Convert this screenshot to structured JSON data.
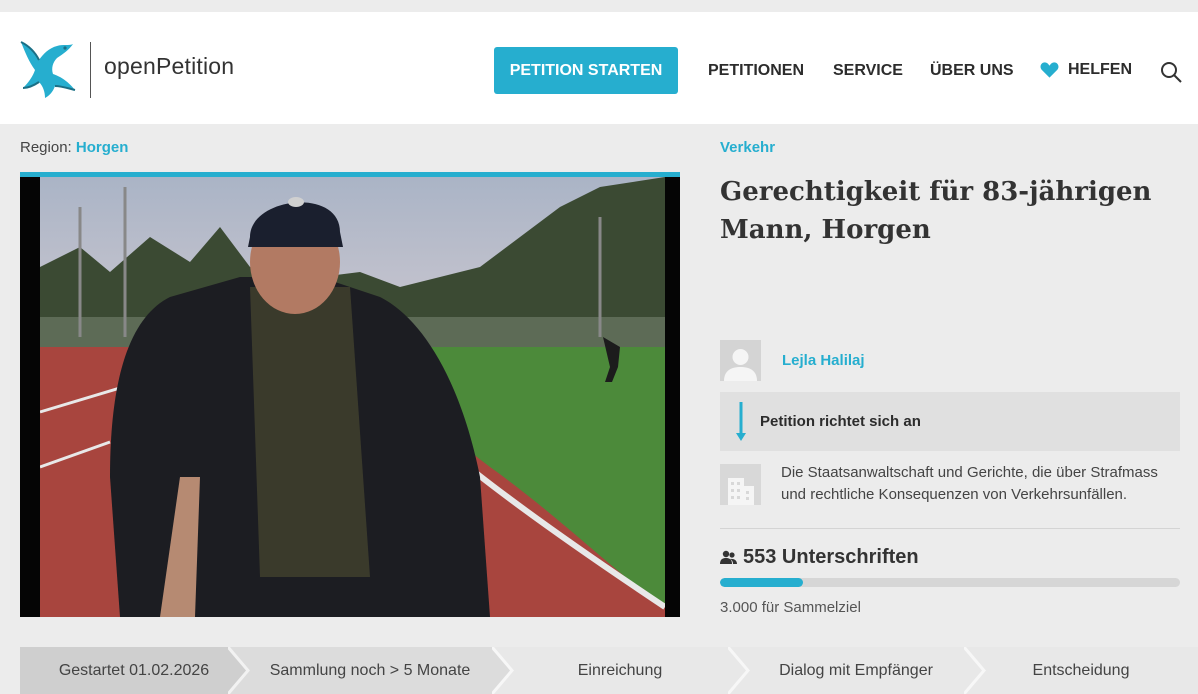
{
  "header": {
    "logo_text": "openPetition",
    "start_button": "PETITION STARTEN",
    "nav": {
      "petitionen": "PETITIONEN",
      "service": "SERVICE",
      "ueber_uns": "ÜBER UNS",
      "helfen": "HELFEN"
    },
    "icons": [
      "dove-logo-icon",
      "heart-icon",
      "search-icon"
    ]
  },
  "petition": {
    "region_label": "Region:",
    "region_value": "Horgen",
    "category": "Verkehr",
    "title": "Gerechtigkeit für 83-jährigen Mann, Horgen",
    "author": "Lejla Halilaj",
    "addressee_heading": "Petition richtet sich an",
    "addressee_text": "Die Staatsanwaltschaft und Gerichte, die über Strafmass und rechtliche Konsequenzen von Verkehrsunfällen.",
    "signatures": "553 Unterschriften",
    "progress_fraction": 0.18,
    "goal": "3.000 für Sammelziel"
  },
  "steps": [
    "Gestartet 01.02.2026",
    "Sammlung noch > 5 Monate",
    "Einreichung",
    "Dialog mit Empfänger",
    "Entscheidung"
  ],
  "colors": {
    "accent": "#26aecf",
    "background": "#ececec",
    "text": "#333333"
  }
}
